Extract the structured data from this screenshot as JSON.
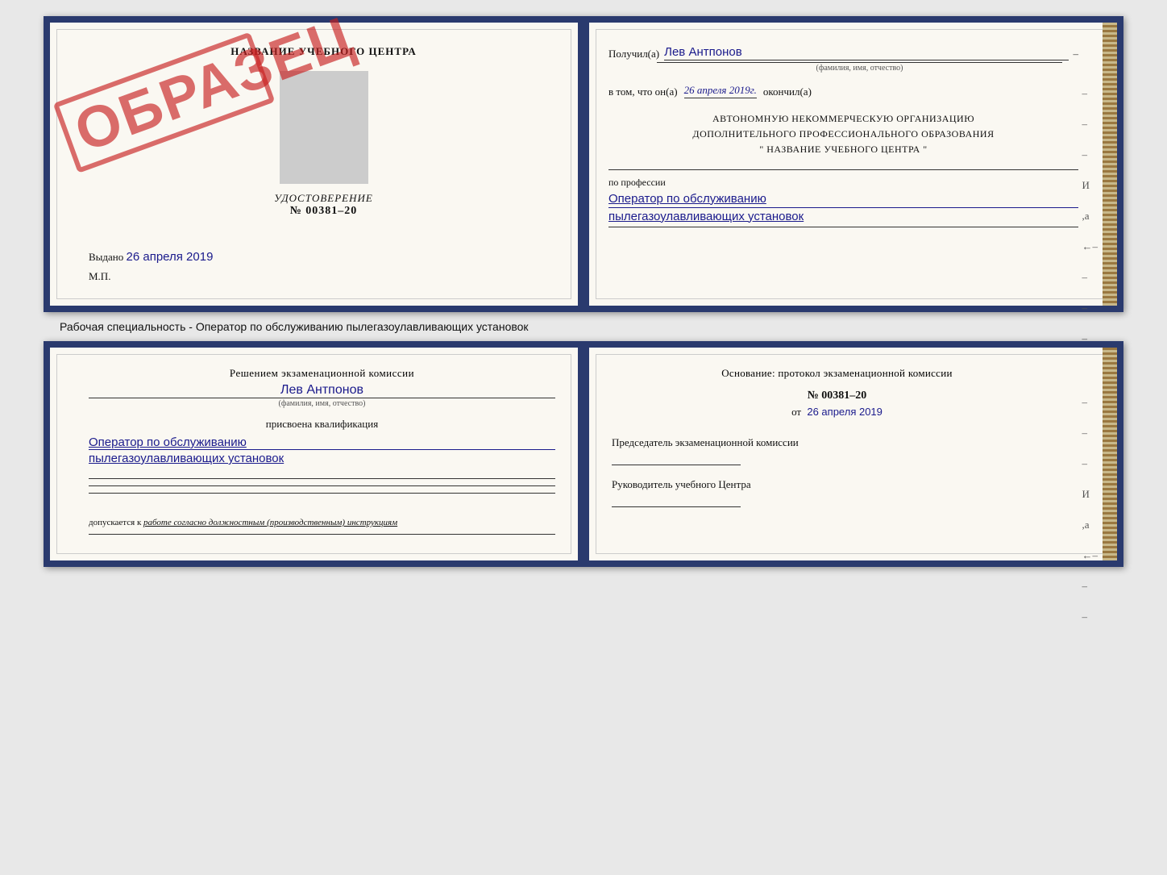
{
  "upper_cert": {
    "left": {
      "title": "НАЗВАНИЕ УЧЕБНОГО ЦЕНТРА",
      "stamp": "ОБРАЗЕЦ",
      "udostoverenie_label": "УДОСТОВЕРЕНИЕ",
      "udostoverenie_number": "№ 00381–20",
      "vydano_label": "Выдано",
      "vydano_date": "26 апреля 2019",
      "mp_label": "М.П."
    },
    "right": {
      "poluchil_label": "Получил(а)",
      "poluchil_name": "Лев Антпонов",
      "fio_sub": "(фамилия, имя, отчество)",
      "dash": "–",
      "vtom_label": "в том, что он(а)",
      "vtom_date": "26 апреля 2019г.",
      "okonchil_label": "окончил(а)",
      "org_line1": "АВТОНОМНУЮ НЕКОММЕРЧЕСКУЮ ОРГАНИЗАЦИЮ",
      "org_line2": "ДОПОЛНИТЕЛЬНОГО ПРОФЕССИОНАЛЬНОГО ОБРАЗОВАНИЯ",
      "org_line3": "\" НАЗВАНИЕ УЧЕБНОГО ЦЕНТРА \"",
      "po_professii": "по профессии",
      "profession1": "Оператор по обслуживанию",
      "profession2": "пылегазоулавливающих установок",
      "dashes": [
        "–",
        "–",
        "–",
        "И",
        ",а",
        "←–",
        "–",
        "–",
        "–",
        "–"
      ]
    }
  },
  "subtitle": "Рабочая специальность - Оператор по обслуживанию пылегазоулавливающих установок",
  "lower_cert": {
    "left": {
      "resheniyem_title": "Решением экзаменационной комиссии",
      "name": "Лев Антпонов",
      "fio_sub": "(фамилия, имя, отчество)",
      "prisvoena": "присвоена квалификация",
      "qual1": "Оператор по обслуживанию",
      "qual2": "пылегазоулавливающих установок",
      "dopuskaetsya_label": "допускается к",
      "dopuskaetsya_value": "работе согласно должностным (производственным) инструкциям"
    },
    "right": {
      "osnovanie_title": "Основание: протокол экзаменационной комиссии",
      "number": "№  00381–20",
      "ot_label": "от",
      "ot_date": "26 апреля 2019",
      "predsedatel_label": "Председатель экзаменационной комиссии",
      "rukovoditel_label": "Руководитель учебного Центра",
      "dashes": [
        "–",
        "–",
        "–",
        "И",
        ",а",
        "←–",
        "–",
        "–"
      ]
    }
  }
}
